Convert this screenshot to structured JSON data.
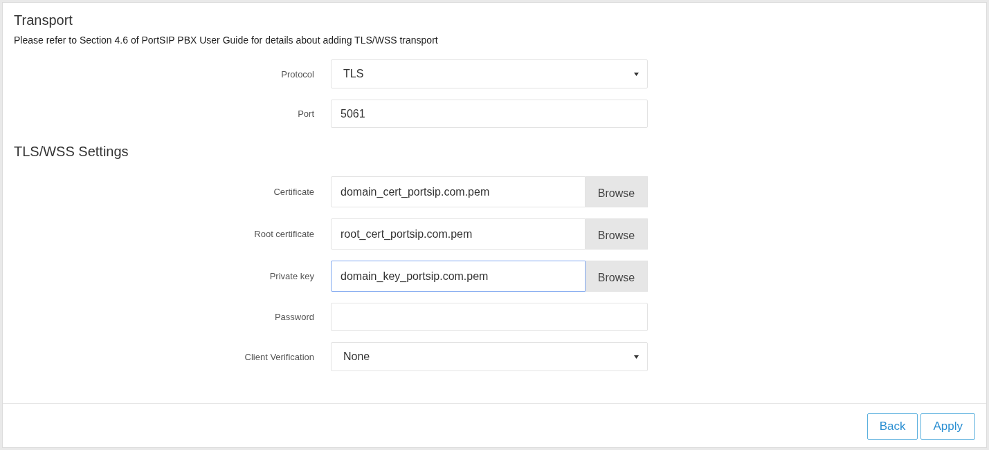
{
  "transport": {
    "title": "Transport",
    "note": "Please refer to Section 4.6 of PortSIP PBX User Guide for details about adding TLS/WSS transport",
    "fields": [
      {
        "kind": "select",
        "label": "Protocol",
        "value": "TLS",
        "focused": false
      },
      {
        "kind": "text",
        "label": "Port",
        "value": "5061",
        "focused": false
      }
    ]
  },
  "tls_settings": {
    "title": "TLS/WSS Settings",
    "fields": [
      {
        "kind": "file",
        "label": "Certificate",
        "value": "domain_cert_portsip.com.pem",
        "button": "Browse",
        "focused": false
      },
      {
        "kind": "file",
        "label": "Root certificate",
        "value": "root_cert_portsip.com.pem",
        "button": "Browse",
        "focused": false
      },
      {
        "kind": "file",
        "label": "Private key",
        "value": "domain_key_portsip.com.pem",
        "button": "Browse",
        "focused": true
      },
      {
        "kind": "text",
        "label": "Password",
        "focused": false
      },
      {
        "kind": "select",
        "label": "Client Verification",
        "value": "None",
        "focused": false
      }
    ]
  },
  "footer": {
    "buttons": [
      "Back",
      "Apply"
    ]
  }
}
